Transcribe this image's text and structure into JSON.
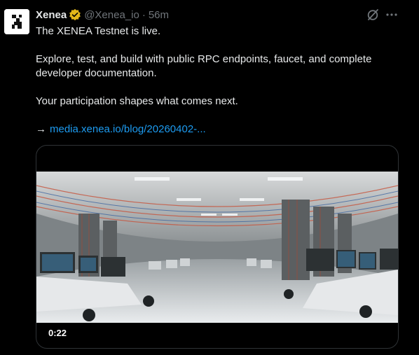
{
  "author": {
    "name": "Xenea",
    "handle": "@Xenea_io",
    "separator": "·",
    "time": "56m"
  },
  "post": {
    "line1": "The XENEA Testnet is live.",
    "line2": "Explore, test, and build with public RPC endpoints, faucet, and complete developer documentation.",
    "line3": "Your participation shapes what comes next.",
    "arrow": "→",
    "link_text": "media.xenea.io/blog/20260402-..."
  },
  "media": {
    "duration": "0:22"
  },
  "icons": {
    "verified": "verified-badge-icon",
    "grok": "grok-icon",
    "more": "more-icon"
  },
  "colors": {
    "background": "#000000",
    "text": "#e7e9ea",
    "muted": "#71767b",
    "link": "#1d9bf0",
    "verified": "#e2b719"
  }
}
